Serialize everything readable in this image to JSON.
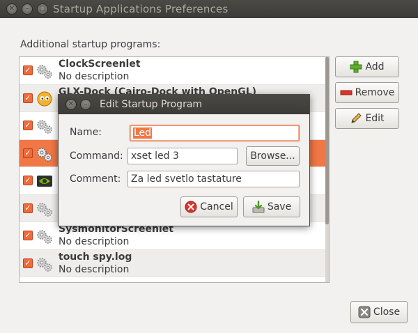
{
  "window": {
    "title": "Startup Applications Preferences",
    "section_label": "Additional startup programs:"
  },
  "programs": [
    {
      "name": "ClockScreenlet",
      "description": "No description",
      "icon": "gears-icon",
      "checked": true
    },
    {
      "name": "GLX-Dock (Cairo-Dock with OpenGL)",
      "description": "",
      "icon": "cairo-dock-icon",
      "checked": true
    },
    {
      "name": "",
      "description": "",
      "icon": "gears-icon",
      "checked": true
    },
    {
      "name": "",
      "description": "",
      "icon": "gears-icon",
      "checked": true,
      "selected": true
    },
    {
      "name": "",
      "description": "",
      "icon": "nvidia-icon",
      "checked": true
    },
    {
      "name": "",
      "description": "",
      "icon": "gears-icon",
      "checked": true
    },
    {
      "name": "SysmonitorScreenlet",
      "description": "No description",
      "icon": "gears-icon",
      "checked": true
    },
    {
      "name": "touch spy.log",
      "description": "No description",
      "icon": "gears-icon",
      "checked": true
    }
  ],
  "buttons": {
    "add": "Add",
    "remove": "Remove",
    "edit": "Edit",
    "close": "Close"
  },
  "dialog": {
    "title": "Edit Startup Program",
    "name_label": "Name:",
    "name_value": "Led",
    "command_label": "Command:",
    "command_value": "xset led 3",
    "browse": "Browse...",
    "comment_label": "Comment:",
    "comment_value": "Za led svetlo tastature",
    "cancel": "Cancel",
    "save": "Save"
  },
  "colors": {
    "accent": "#f07746",
    "titlebar": "#3c3b37",
    "window_bg": "#f2f1f0"
  }
}
